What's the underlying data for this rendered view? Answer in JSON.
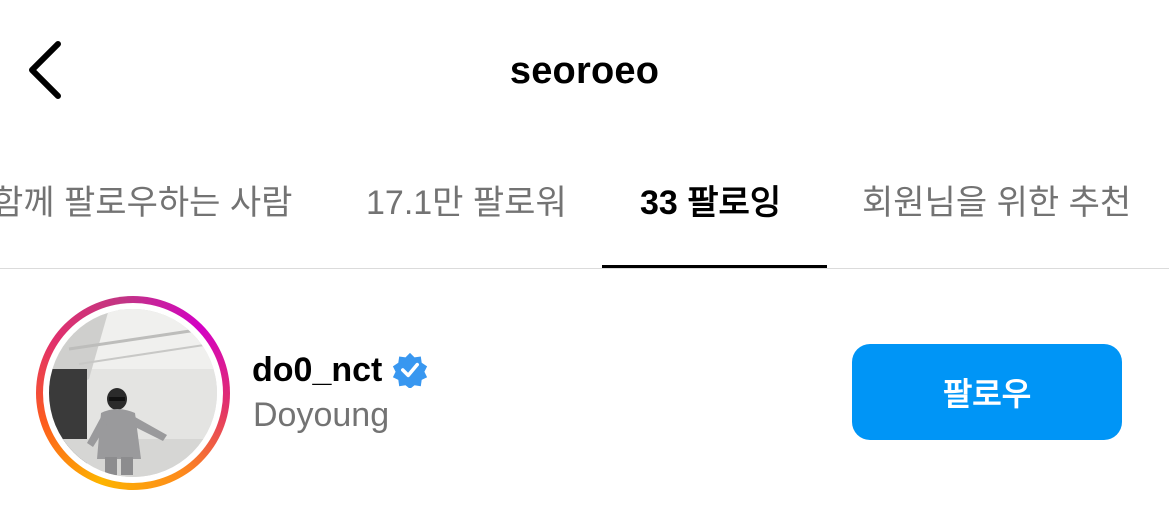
{
  "header": {
    "back_icon": "chevron-left-icon",
    "title": "seoroeo"
  },
  "tabs": [
    {
      "label": "함께 팔로우하는 사람",
      "active": false
    },
    {
      "label": "17.1만 팔로워",
      "active": false
    },
    {
      "label": "33 팔로잉",
      "active": true
    },
    {
      "label": "회원님을 위한 추천",
      "active": false
    }
  ],
  "user": {
    "username": "do0_nct",
    "verified": true,
    "full_name": "Doyoung",
    "follow_label": "팔로우"
  },
  "colors": {
    "accent": "#0095f6",
    "muted_text": "#737373",
    "verified": "#3897f0",
    "divider": "#dbdbdb"
  }
}
